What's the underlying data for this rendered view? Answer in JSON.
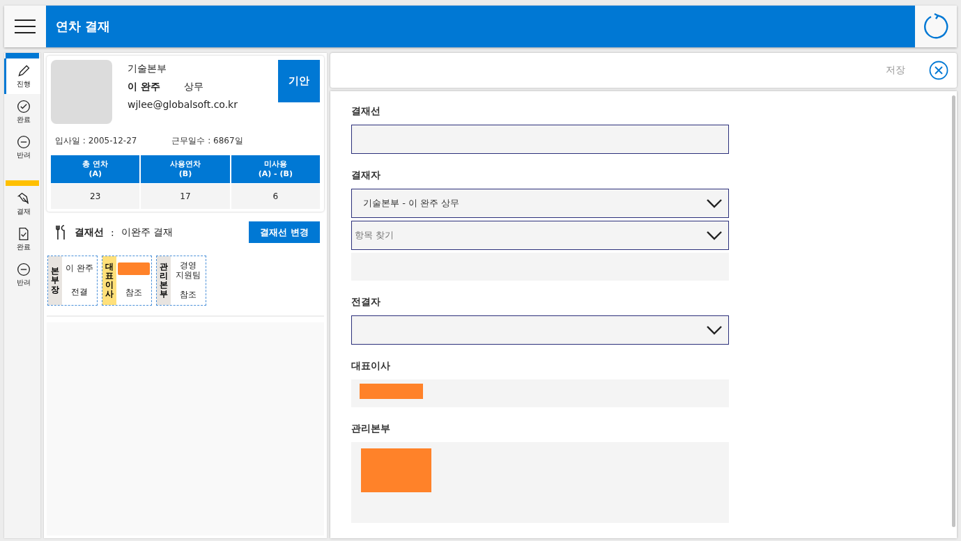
{
  "header": {
    "title": "연차 결재"
  },
  "sidebar": {
    "groups": [
      {
        "color": "#0078d4",
        "items": [
          {
            "kind": "pencil",
            "label": "진행",
            "selected": true
          },
          {
            "kind": "check",
            "label": "완료",
            "selected": false
          },
          {
            "kind": "reject",
            "label": "반려",
            "selected": false
          }
        ]
      },
      {
        "color": "#ffc000",
        "items": [
          {
            "kind": "pen",
            "label": "결재",
            "selected": false
          },
          {
            "kind": "document",
            "label": "완료",
            "selected": false
          },
          {
            "kind": "reject",
            "label": "반려",
            "selected": false
          }
        ]
      }
    ]
  },
  "profile": {
    "department": "기술본부",
    "name": "이 완주",
    "position": "상무",
    "email": "wjlee@globalsoft.co.kr",
    "draft_button": "기안",
    "join_date": "입사일 : 2005-12-27",
    "work_days": "근무일수 : 6867일",
    "leave_table": {
      "columns": [
        [
          "총 연차",
          "(A)"
        ],
        [
          "사용연차",
          "(B)"
        ],
        [
          "미사용",
          "(A) - (B)"
        ]
      ],
      "values": [
        "23",
        "17",
        "6"
      ]
    }
  },
  "approval_line": {
    "label": "결재선",
    "separator": ":",
    "value": "이완주 결재",
    "change_button": "결재선 변경",
    "cards": [
      {
        "role": "본부장",
        "color": "#e8e4e0",
        "kind": "text",
        "name": "이 완주",
        "type": "전결"
      },
      {
        "role": "대표이사",
        "color": "#ffe07a",
        "kind": "redacted",
        "type": "참조"
      },
      {
        "role": "관리본부",
        "color": "#e8e4e0",
        "kind": "text",
        "name": "경영\n지원팀",
        "type": "참조"
      }
    ]
  },
  "toolbar": {
    "save": "저장"
  },
  "form": [
    {
      "label": "결재선",
      "fields": [
        {
          "kind": "textbox"
        }
      ]
    },
    {
      "label": "결재자",
      "fields": [
        {
          "kind": "select",
          "value": "기술본부 - 이 완주 상무"
        },
        {
          "kind": "select",
          "placeholder": "항목 찾기"
        },
        {
          "kind": "blank"
        }
      ]
    },
    {
      "label": "전결자",
      "fields": [
        {
          "kind": "select"
        }
      ]
    },
    {
      "label": "대표이사",
      "fields": [
        {
          "kind": "redacted"
        }
      ]
    },
    {
      "label": "관리본부",
      "fields": [
        {
          "kind": "redactedlarge"
        }
      ]
    }
  ]
}
